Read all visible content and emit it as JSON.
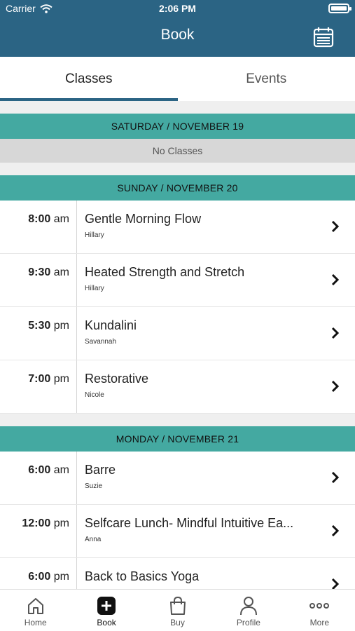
{
  "status_bar": {
    "carrier": "Carrier",
    "time": "2:06 PM"
  },
  "nav": {
    "title": "Book",
    "calendar_icon": "calendar-icon"
  },
  "tabs": [
    {
      "label": "Classes",
      "active": true
    },
    {
      "label": "Events",
      "active": false
    }
  ],
  "days": [
    {
      "header": "SATURDAY / NOVEMBER 19",
      "empty_text": "No Classes",
      "classes": []
    },
    {
      "header": "SUNDAY / NOVEMBER 20",
      "classes": [
        {
          "time": "8:00",
          "ampm": "am",
          "name": "Gentle Morning Flow",
          "instructor": "Hillary"
        },
        {
          "time": "9:30",
          "ampm": "am",
          "name": "Heated Strength and Stretch",
          "instructor": "Hillary"
        },
        {
          "time": "5:30",
          "ampm": "pm",
          "name": "Kundalini",
          "instructor": "Savannah"
        },
        {
          "time": "7:00",
          "ampm": "pm",
          "name": "Restorative",
          "instructor": "Nicole"
        }
      ]
    },
    {
      "header": "MONDAY / NOVEMBER 21",
      "classes": [
        {
          "time": "6:00",
          "ampm": "am",
          "name": "Barre",
          "instructor": "Suzie"
        },
        {
          "time": "12:00",
          "ampm": "pm",
          "name": "Selfcare Lunch- Mindful Intuitive Ea...",
          "instructor": "Anna"
        },
        {
          "time": "6:00",
          "ampm": "pm",
          "name": "Back to Basics Yoga",
          "instructor": ""
        }
      ]
    }
  ],
  "tabbar": [
    {
      "label": "Home",
      "icon": "home-icon",
      "active": false
    },
    {
      "label": "Book",
      "icon": "plus-square-icon",
      "active": true
    },
    {
      "label": "Buy",
      "icon": "shopping-bag-icon",
      "active": false
    },
    {
      "label": "Profile",
      "icon": "person-icon",
      "active": false
    },
    {
      "label": "More",
      "icon": "more-dots-icon",
      "active": false
    }
  ],
  "colors": {
    "nav_bar": "#2b6484",
    "day_header": "#44a9a1",
    "no_classes_bg": "#d7d7d7"
  }
}
